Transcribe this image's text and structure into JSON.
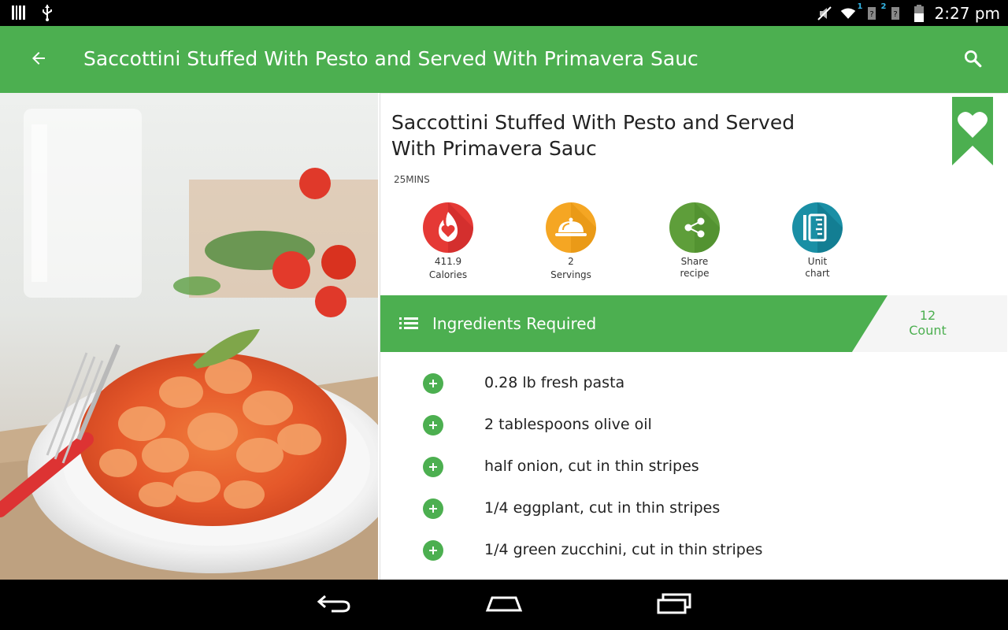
{
  "status_bar": {
    "time": "2:27 pm",
    "sim1_label": "1",
    "sim2_label": "2",
    "icons": [
      "barcode-icon",
      "usb-icon",
      "mute-icon",
      "wifi-icon",
      "sim1-signal-icon",
      "sim2-signal-icon",
      "battery-icon"
    ]
  },
  "app_bar": {
    "title": "Saccottini Stuffed With Pesto and Served With Primavera Sauc",
    "back_icon": "arrow-back-icon",
    "search_icon": "search-icon"
  },
  "recipe": {
    "title_line1": "Saccottini Stuffed With Pesto and Served",
    "title_line2": "With Primavera Sauc",
    "time": "25MINS",
    "favorite_icon": "heart-bookmark-icon"
  },
  "actions": [
    {
      "line1": "411.9",
      "line2": "Calories",
      "icon": "calories-heart-icon",
      "color": "#e53935"
    },
    {
      "line1": "2",
      "line2": "Servings",
      "icon": "serving-dish-icon",
      "color": "#f5a623"
    },
    {
      "line1": "Share",
      "line2": "recipe",
      "icon": "share-icon",
      "color": "#5e9e3a"
    },
    {
      "line1": "Unit",
      "line2": "chart",
      "icon": "unit-chart-icon",
      "color": "#1a8fa5"
    }
  ],
  "ingredients": {
    "title": "Ingredients Required",
    "count_value": "12",
    "count_label": "Count",
    "items": [
      "0.28 lb fresh pasta",
      "2 tablespoons olive oil",
      "half onion, cut in thin stripes",
      "1/4 eggplant, cut in thin stripes",
      "1/4 green zucchini, cut in thin stripes"
    ]
  },
  "colors": {
    "primary": "#4caf50",
    "calories": "#e53935",
    "servings": "#f5a623",
    "share": "#5e9e3a",
    "unit_chart": "#1a8fa5"
  },
  "nav_bar": {
    "buttons": [
      "back-nav-icon",
      "home-nav-icon",
      "recents-nav-icon"
    ]
  }
}
